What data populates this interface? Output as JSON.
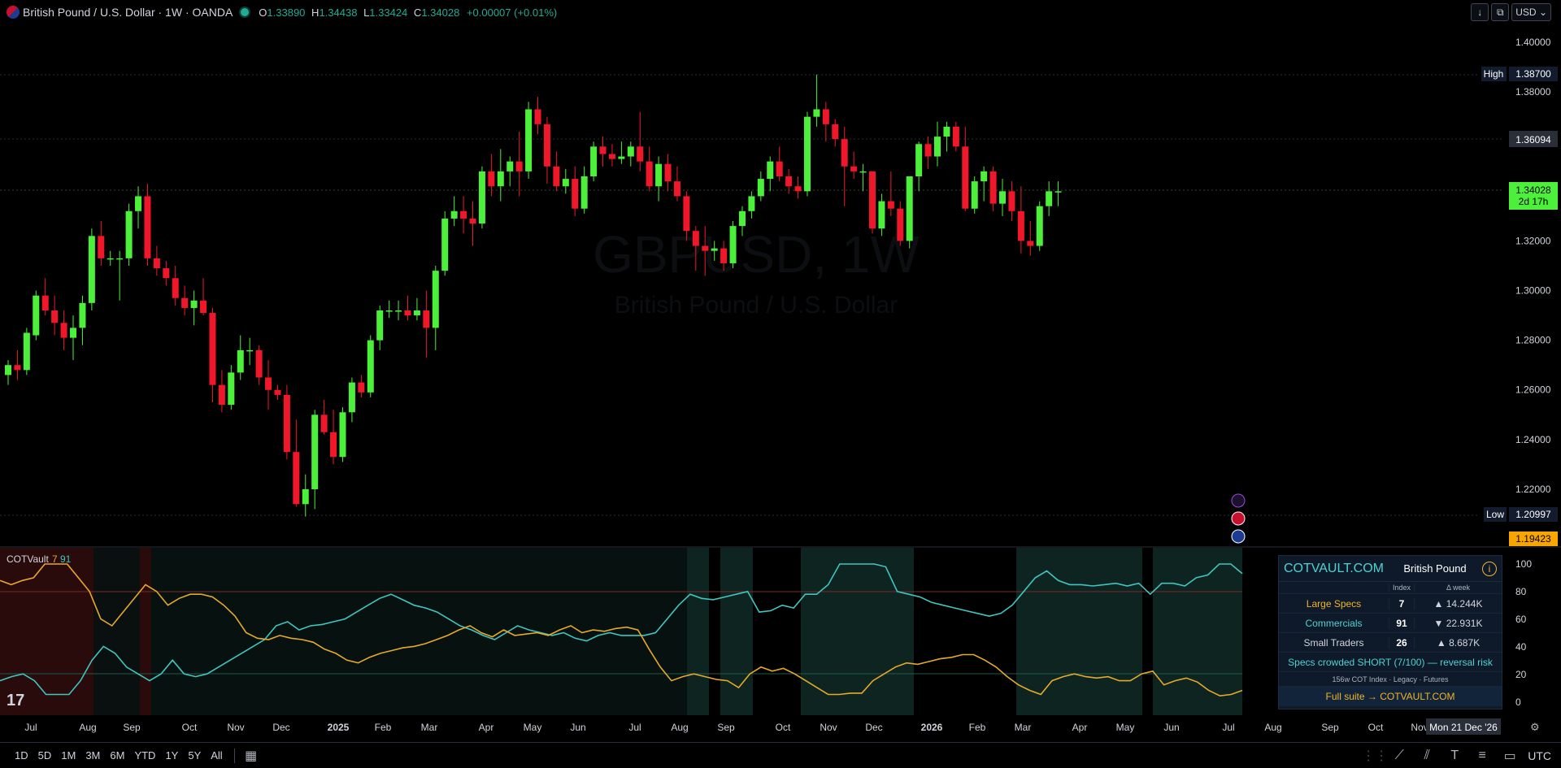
{
  "header": {
    "symbol": "British Pound / U.S. Dollar · 1W · OANDA",
    "o_label": "O",
    "o": "1.33890",
    "h_label": "H",
    "h": "1.34438",
    "l_label": "L",
    "l": "1.33424",
    "c_label": "C",
    "c": "1.34028",
    "change": "+0.00007 (+0.01%)"
  },
  "top_right": {
    "currency": "USD"
  },
  "watermark": {
    "line1": "GBPUSD, 1W",
    "line2": "British Pound / U.S. Dollar"
  },
  "price_axis": {
    "ticks": [
      "1.40000",
      "1.38000",
      "1.36000",
      "1.34000",
      "1.32000",
      "1.30000",
      "1.28000",
      "1.26000",
      "1.24000",
      "1.22000"
    ],
    "high_label": "High",
    "high_value": "1.38700",
    "low_label": "Low",
    "low_value": "1.20997",
    "line_value": "1.36094",
    "last_value": "1.34028",
    "countdown": "2d 17h",
    "bottom_value": "1.19423"
  },
  "indicator": {
    "name": "COTVault",
    "value1": "7",
    "value2": "91",
    "axis_ticks": [
      "100",
      "80",
      "60",
      "40",
      "20",
      "0"
    ]
  },
  "time_axis": {
    "labels": [
      "Jul",
      "Aug",
      "Sep",
      "Oct",
      "Nov",
      "Dec",
      "2025",
      "Feb",
      "Mar",
      "Apr",
      "May",
      "Jun",
      "Jul",
      "Aug",
      "Sep",
      "Oct",
      "Nov",
      "Dec",
      "2026",
      "Feb",
      "Mar",
      "Apr",
      "May",
      "Jun",
      "Jul",
      "Aug",
      "Sep",
      "Oct",
      "Nov"
    ],
    "crosshair_date": "Mon 21 Dec '26"
  },
  "cot_panel": {
    "brand": "COTVAULT.COM",
    "market": "British Pound",
    "info_icon": "info-icon",
    "col_index": "Index",
    "col_delta": "Δ week",
    "rows": [
      {
        "label": "Large Specs",
        "index": "7",
        "delta": "▲ 14.244K",
        "color": "#f0b429"
      },
      {
        "label": "Commercials",
        "index": "91",
        "delta": "▼ 22.931K",
        "color": "#4dd2d2"
      },
      {
        "label": "Small Traders",
        "index": "26",
        "delta": "▲ 8.687K",
        "color": "#d1d4dc"
      }
    ],
    "alert": "Specs crowded SHORT (7/100) — reversal risk",
    "meta": "156w COT Index · Legacy · Futures",
    "cta": "Full suite → COTVAULT.COM"
  },
  "footer": {
    "timeframes": [
      "1D",
      "5D",
      "1M",
      "3M",
      "6M",
      "YTD",
      "1Y",
      "5Y",
      "All"
    ],
    "timezone": "UTC"
  },
  "colors": {
    "up": "#4cef3a",
    "down": "#f0172a",
    "commercials": "#3fc6c0",
    "specs": "#e6a92b",
    "last_price": "#4cef3a"
  },
  "chart_data": [
    {
      "type": "candlestick",
      "title": "GBPUSD, 1W",
      "ylim": [
        1.19,
        1.405
      ],
      "interval": "1W",
      "ohlc": [
        [
          1.266,
          1.272,
          1.262,
          1.27
        ],
        [
          1.27,
          1.276,
          1.264,
          1.268
        ],
        [
          1.268,
          1.285,
          1.266,
          1.283
        ],
        [
          1.282,
          1.3,
          1.28,
          1.298
        ],
        [
          1.298,
          1.305,
          1.29,
          1.292
        ],
        [
          1.292,
          1.298,
          1.282,
          1.287
        ],
        [
          1.287,
          1.292,
          1.276,
          1.281
        ],
        [
          1.281,
          1.29,
          1.272,
          1.285
        ],
        [
          1.285,
          1.298,
          1.278,
          1.295
        ],
        [
          1.295,
          1.325,
          1.292,
          1.322
        ],
        [
          1.322,
          1.328,
          1.31,
          1.313
        ],
        [
          1.313,
          1.316,
          1.31,
          1.313
        ],
        [
          1.313,
          1.316,
          1.296,
          1.313
        ],
        [
          1.313,
          1.335,
          1.31,
          1.332
        ],
        [
          1.332,
          1.342,
          1.325,
          1.338
        ],
        [
          1.338,
          1.343,
          1.31,
          1.313
        ],
        [
          1.313,
          1.318,
          1.306,
          1.309
        ],
        [
          1.309,
          1.312,
          1.302,
          1.305
        ],
        [
          1.305,
          1.31,
          1.294,
          1.297
        ],
        [
          1.297,
          1.302,
          1.29,
          1.293
        ],
        [
          1.293,
          1.3,
          1.286,
          1.296
        ],
        [
          1.296,
          1.305,
          1.29,
          1.291
        ],
        [
          1.291,
          1.293,
          1.255,
          1.262
        ],
        [
          1.262,
          1.268,
          1.251,
          1.254
        ],
        [
          1.254,
          1.27,
          1.252,
          1.267
        ],
        [
          1.267,
          1.282,
          1.264,
          1.276
        ],
        [
          1.276,
          1.281,
          1.27,
          1.276
        ],
        [
          1.276,
          1.278,
          1.262,
          1.265
        ],
        [
          1.265,
          1.272,
          1.252,
          1.26
        ],
        [
          1.26,
          1.262,
          1.256,
          1.258
        ],
        [
          1.258,
          1.262,
          1.232,
          1.235
        ],
        [
          1.235,
          1.248,
          1.213,
          1.214
        ],
        [
          1.214,
          1.226,
          1.209,
          1.22
        ],
        [
          1.22,
          1.252,
          1.212,
          1.25
        ],
        [
          1.25,
          1.256,
          1.242,
          1.243
        ],
        [
          1.243,
          1.252,
          1.23,
          1.233
        ],
        [
          1.233,
          1.253,
          1.231,
          1.251
        ],
        [
          1.251,
          1.265,
          1.247,
          1.263
        ],
        [
          1.263,
          1.266,
          1.257,
          1.259
        ],
        [
          1.259,
          1.282,
          1.257,
          1.28
        ],
        [
          1.28,
          1.294,
          1.276,
          1.292
        ],
        [
          1.292,
          1.296,
          1.289,
          1.292
        ],
        [
          1.292,
          1.296,
          1.288,
          1.292
        ],
        [
          1.292,
          1.298,
          1.288,
          1.29
        ],
        [
          1.29,
          1.297,
          1.288,
          1.292
        ],
        [
          1.292,
          1.3,
          1.273,
          1.285
        ],
        [
          1.285,
          1.31,
          1.276,
          1.308
        ],
        [
          1.308,
          1.332,
          1.306,
          1.329
        ],
        [
          1.329,
          1.338,
          1.326,
          1.332
        ],
        [
          1.332,
          1.338,
          1.323,
          1.329
        ],
        [
          1.329,
          1.336,
          1.318,
          1.327
        ],
        [
          1.327,
          1.35,
          1.325,
          1.348
        ],
        [
          1.348,
          1.355,
          1.338,
          1.342
        ],
        [
          1.342,
          1.357,
          1.336,
          1.348
        ],
        [
          1.348,
          1.354,
          1.342,
          1.352
        ],
        [
          1.352,
          1.364,
          1.338,
          1.348
        ],
        [
          1.348,
          1.376,
          1.345,
          1.373
        ],
        [
          1.373,
          1.378,
          1.363,
          1.367
        ],
        [
          1.367,
          1.37,
          1.343,
          1.35
        ],
        [
          1.35,
          1.356,
          1.34,
          1.342
        ],
        [
          1.342,
          1.349,
          1.339,
          1.345
        ],
        [
          1.345,
          1.35,
          1.33,
          1.333
        ],
        [
          1.333,
          1.35,
          1.331,
          1.346
        ],
        [
          1.346,
          1.36,
          1.344,
          1.358
        ],
        [
          1.358,
          1.362,
          1.35,
          1.355
        ],
        [
          1.355,
          1.359,
          1.35,
          1.353
        ],
        [
          1.353,
          1.36,
          1.351,
          1.354
        ],
        [
          1.354,
          1.36,
          1.35,
          1.358
        ],
        [
          1.358,
          1.372,
          1.348,
          1.352
        ],
        [
          1.352,
          1.358,
          1.34,
          1.342
        ],
        [
          1.342,
          1.354,
          1.336,
          1.351
        ],
        [
          1.351,
          1.355,
          1.34,
          1.344
        ],
        [
          1.344,
          1.35,
          1.336,
          1.338
        ],
        [
          1.338,
          1.34,
          1.32,
          1.324
        ],
        [
          1.324,
          1.326,
          1.308,
          1.318
        ],
        [
          1.318,
          1.326,
          1.306,
          1.316
        ],
        [
          1.316,
          1.32,
          1.312,
          1.317
        ],
        [
          1.317,
          1.32,
          1.308,
          1.311
        ],
        [
          1.311,
          1.328,
          1.309,
          1.326
        ],
        [
          1.326,
          1.334,
          1.322,
          1.332
        ],
        [
          1.332,
          1.34,
          1.329,
          1.338
        ],
        [
          1.338,
          1.348,
          1.336,
          1.345
        ],
        [
          1.345,
          1.354,
          1.34,
          1.352
        ],
        [
          1.352,
          1.358,
          1.344,
          1.346
        ],
        [
          1.346,
          1.349,
          1.339,
          1.342
        ],
        [
          1.342,
          1.346,
          1.337,
          1.34
        ],
        [
          1.34,
          1.372,
          1.338,
          1.37
        ],
        [
          1.37,
          1.387,
          1.366,
          1.373
        ],
        [
          1.373,
          1.376,
          1.36,
          1.367
        ],
        [
          1.367,
          1.369,
          1.358,
          1.361
        ],
        [
          1.361,
          1.366,
          1.334,
          1.35
        ],
        [
          1.35,
          1.356,
          1.345,
          1.348
        ],
        [
          1.348,
          1.351,
          1.34,
          1.348
        ],
        [
          1.348,
          1.348,
          1.323,
          1.325
        ],
        [
          1.325,
          1.339,
          1.322,
          1.336
        ],
        [
          1.336,
          1.348,
          1.33,
          1.333
        ],
        [
          1.333,
          1.336,
          1.318,
          1.32
        ],
        [
          1.32,
          1.346,
          1.317,
          1.346
        ],
        [
          1.346,
          1.36,
          1.34,
          1.359
        ],
        [
          1.359,
          1.362,
          1.349,
          1.354
        ],
        [
          1.354,
          1.368,
          1.35,
          1.362
        ],
        [
          1.362,
          1.368,
          1.356,
          1.366
        ],
        [
          1.366,
          1.368,
          1.356,
          1.358
        ],
        [
          1.358,
          1.366,
          1.332,
          1.333
        ],
        [
          1.333,
          1.346,
          1.331,
          1.344
        ],
        [
          1.344,
          1.35,
          1.336,
          1.348
        ],
        [
          1.348,
          1.35,
          1.332,
          1.335
        ],
        [
          1.335,
          1.345,
          1.33,
          1.34
        ],
        [
          1.34,
          1.344,
          1.328,
          1.332
        ],
        [
          1.332,
          1.342,
          1.315,
          1.32
        ],
        [
          1.32,
          1.328,
          1.314,
          1.318
        ],
        [
          1.318,
          1.336,
          1.316,
          1.334
        ],
        [
          1.334,
          1.344,
          1.33,
          1.34
        ],
        [
          1.34,
          1.344,
          1.334,
          1.34
        ]
      ]
    },
    {
      "type": "line",
      "ylim": [
        0,
        100
      ],
      "series": [
        {
          "values": [
            15,
            18,
            20,
            15,
            5,
            5,
            5,
            15,
            30,
            40,
            35,
            25,
            20,
            15,
            20,
            30,
            20,
            18,
            20,
            25,
            30,
            35,
            40,
            45,
            55,
            58,
            52,
            55,
            56,
            58,
            60,
            65,
            70,
            75,
            78,
            74,
            70,
            68,
            65,
            60,
            55,
            52,
            48,
            45,
            50,
            55,
            52,
            50,
            48,
            50,
            46,
            44,
            48,
            50,
            48,
            48,
            48,
            50,
            60,
            70,
            78,
            75,
            74,
            76,
            78,
            80,
            65,
            66,
            70,
            68,
            78,
            78,
            85,
            100,
            100,
            100,
            100,
            98,
            80,
            78,
            76,
            72,
            70,
            68,
            66,
            64,
            62,
            64,
            70,
            80,
            90,
            95,
            88,
            85,
            85,
            84,
            85,
            86,
            84,
            86,
            78,
            86,
            86,
            84,
            90,
            92,
            100,
            100,
            93
          ]
        },
        {
          "values": [
            88,
            85,
            88,
            90,
            100,
            100,
            100,
            90,
            80,
            60,
            55,
            65,
            75,
            85,
            80,
            70,
            75,
            78,
            78,
            76,
            70,
            62,
            50,
            46,
            45,
            48,
            46,
            45,
            43,
            38,
            35,
            30,
            28,
            32,
            35,
            37,
            39,
            40,
            42,
            45,
            48,
            52,
            55,
            50,
            47,
            52,
            48,
            49,
            50,
            48,
            52,
            55,
            50,
            52,
            51,
            53,
            54,
            52,
            38,
            25,
            15,
            18,
            20,
            18,
            16,
            15,
            10,
            20,
            25,
            22,
            24,
            20,
            15,
            10,
            5,
            5,
            6,
            6,
            15,
            20,
            25,
            28,
            27,
            29,
            31,
            32,
            34,
            34,
            30,
            25,
            18,
            12,
            8,
            5,
            15,
            18,
            20,
            18,
            17,
            18,
            15,
            15,
            20,
            22,
            12,
            15,
            17,
            14,
            8,
            4,
            5,
            8
          ]
        }
      ]
    }
  ]
}
